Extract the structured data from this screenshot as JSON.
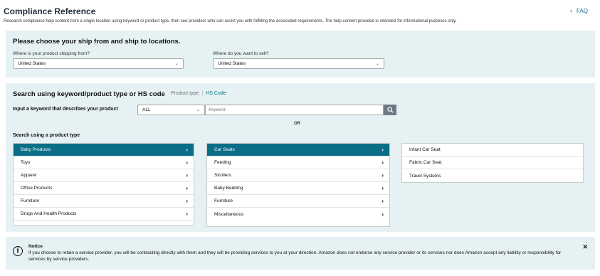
{
  "header": {
    "title": "Compliance Reference",
    "faq_label": "FAQ",
    "subtitle": "Research compliance help content from a single location using keyword or product type, then see providers who can assist you with fulfilling the associated requirements. The help content provided is intended for informational purposes only."
  },
  "locations": {
    "heading": "Please choose your ship from and ship to locations.",
    "ship_from_label": "Where is your product shipping from?",
    "ship_from_value": "United States",
    "ship_to_label": "Where do you want to sell?",
    "ship_to_value": "United States"
  },
  "search": {
    "heading": "Search using keyword/product type or HS code",
    "tab_product_type": "Product type",
    "tab_separator": "|",
    "tab_hs_code": "HS Code",
    "keyword_label": "Input a keyword that describes your product",
    "category_value": "ALL",
    "keyword_placeholder": "Keyword",
    "or_label": "OR",
    "product_type_label": "Search using a product type"
  },
  "categories": {
    "level1": [
      "Baby Products",
      "Toys",
      "Apparel",
      "Office Products",
      "Furniture",
      "Drugs And Health Products"
    ],
    "level2": [
      "Car Seats",
      "Feeding",
      "Strollers",
      "Baby Bedding",
      "Furniture",
      "Miscellaneous"
    ],
    "level3": [
      "Infant Car Seat",
      "Fabric Car Seat",
      "Travel Systems"
    ]
  },
  "notice": {
    "title": "Notice",
    "text": "If you choose to retain a service provider, you will be contracting directly with them and they will be providing services to you at your direction. Amazon does not endorse any service provider or its services nor does Amazon accept any liability or responsibility for services by service providers."
  },
  "colors": {
    "panel_bg": "#e6f1f3",
    "selected_bg": "#0a6e87",
    "link": "#007185"
  },
  "icons": {
    "faq": "chevron-left-icon",
    "select": "chevron-down-icon",
    "search": "search-icon",
    "row": "chevron-right-icon",
    "notice": "info-icon",
    "close": "close-icon"
  }
}
